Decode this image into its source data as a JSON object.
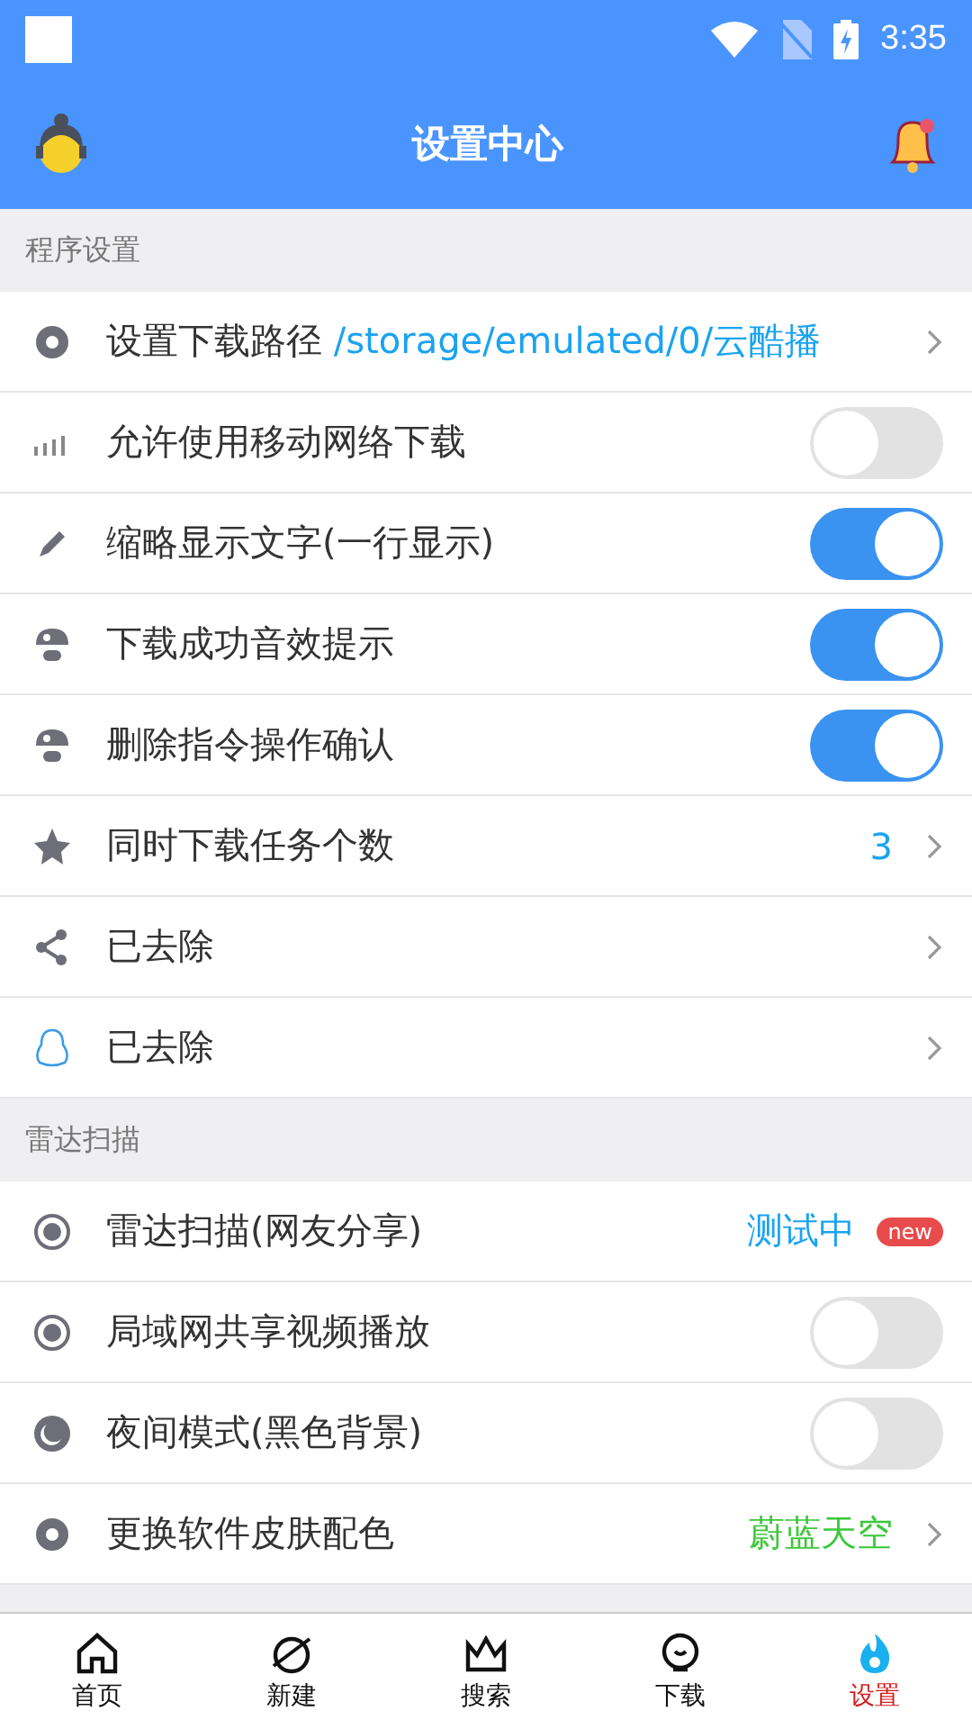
{
  "status_bar": {
    "time": "3:35"
  },
  "header": {
    "title": "设置中心"
  },
  "sections": [
    {
      "title": "程序设置",
      "items": [
        {
          "kind": "link",
          "label": "设置下载路径",
          "inline_value": "/storage/emulated/0/云酷播"
        },
        {
          "kind": "toggle",
          "label": "允许使用移动网络下载",
          "on": false
        },
        {
          "kind": "toggle",
          "label": "缩略显示文字(一行显示)",
          "on": true
        },
        {
          "kind": "toggle",
          "label": "下载成功音效提示",
          "on": true
        },
        {
          "kind": "toggle",
          "label": "删除指令操作确认",
          "on": true
        },
        {
          "kind": "link",
          "label": "同时下载任务个数",
          "value": "3",
          "color": "#1aa3f0"
        },
        {
          "kind": "link",
          "label": "已去除"
        },
        {
          "kind": "link",
          "label": "已去除"
        }
      ]
    },
    {
      "title": "雷达扫描",
      "items": [
        {
          "kind": "badge",
          "label": "雷达扫描(网友分享)",
          "value": "测试中",
          "color": "#1aa3f0",
          "badge": "new"
        },
        {
          "kind": "toggle",
          "label": "局域网共享视频播放",
          "on": false
        },
        {
          "kind": "toggle",
          "label": "夜间模式(黑色背景)",
          "on": false
        },
        {
          "kind": "link",
          "label": "更换软件皮肤配色",
          "value": "蔚蓝天空",
          "color": "#3cc83c"
        }
      ]
    }
  ],
  "tabs": [
    {
      "label": "首页",
      "selected": false
    },
    {
      "label": "新建",
      "selected": false
    },
    {
      "label": "搜索",
      "selected": false
    },
    {
      "label": "下载",
      "selected": false
    },
    {
      "label": "设置",
      "selected": true
    }
  ]
}
